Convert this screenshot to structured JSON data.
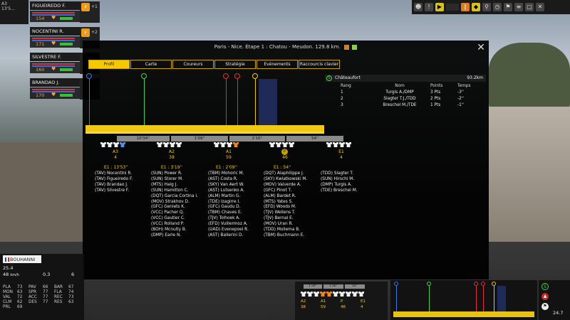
{
  "window": {
    "stage_short": "A3",
    "stage_time": "13'5..."
  },
  "riders": [
    {
      "name": "FIGUEIREDO F.",
      "value": "154",
      "side_badge": "+1"
    },
    {
      "name": "NOCENTINI R.",
      "value": "171",
      "side_badge": "+2"
    },
    {
      "name": "SILVESTRE F.",
      "value": "160",
      "side_badge": ""
    },
    {
      "name": "BRANDAO J.",
      "value": "170",
      "side_badge": ""
    }
  ],
  "modal": {
    "title": "Paris - Nice. Étape 1 : Chatou - Meudon. 129.8 km.",
    "close": "✕",
    "tabs": [
      "Profil",
      "Carte",
      "Coureurs",
      "Stratégie",
      "Evénements",
      "Raccourcis clavier"
    ],
    "active_tab": 0
  },
  "classification": {
    "icon": "S",
    "location": "Châteaufort",
    "distance": "93.2km",
    "columns": {
      "rang": "Rang",
      "nom": "Nom",
      "points": "Points",
      "temps": "Temps"
    },
    "rows": [
      {
        "rang": "1",
        "nom": "Turgis A./DMP",
        "points": "3 Pts",
        "temps": "-3''"
      },
      {
        "rang": "2",
        "nom": "Slagter T.J./TDD",
        "points": "2 Pts",
        "temps": "-2''"
      },
      {
        "rang": "3",
        "nom": "Breschel M./TDE",
        "points": "1 Pts",
        "temps": "-1''"
      }
    ]
  },
  "profile": {
    "markers": [
      {
        "label": "",
        "color": "#3a78e0",
        "pos": 0.02
      },
      {
        "label": "S",
        "color": "#4ad04a",
        "pos": 0.25
      },
      {
        "label": "3",
        "color": "#e03030",
        "pos": 0.58
      },
      {
        "label": "2",
        "color": "#e03030",
        "pos": 0.63
      },
      {
        "label": "S",
        "color": "#f5c800",
        "pos": 0.71
      }
    ]
  },
  "time_gaps": [
    "10'34''",
    "1'09''",
    "1'16''",
    "54''"
  ],
  "groups": [
    {
      "label": "A3",
      "count": "4",
      "gap": "E1 : 13'53''",
      "riders": [
        "(TAV) Nocentini R.",
        "(TAV) Figueiredo F.",
        "(TAV) Brandao J.",
        "(TAV) Silvestre F."
      ]
    },
    {
      "label": "A2",
      "count": "38",
      "gap": "E1 : 3'19''",
      "riders": [
        "(SUN) Power R.",
        "(SUN) Storer M.",
        "(MTS) Haig J.",
        "(SUN) Hamilton C.",
        "(DQT) Garcia Cortina I.",
        "(MOV) Strakhov D.",
        "(GFC) Geniets K.",
        "(VCC) Pacher Q.",
        "(VCC) Gautier C.",
        "(VCC) Rolland P.",
        "(BOH) Mcnulty B.",
        "(DMP) Earle N."
      ]
    },
    {
      "label": "A1",
      "count": "59",
      "gap": "E1 : 2'09''",
      "riders": [
        "(TBM) Mohoric M.",
        "(AST) Costa R.",
        "(SKY) Van Aert W.",
        "(AST) Lutsenko A.",
        "(ALM) Martin G.",
        "(TDE) Izagirre I.",
        "(GFC) Gaudu D.",
        "(TBM) Chaves E.",
        "(TJV) Tolhoek A.",
        "(EFD) Vuillermoz A.",
        "(UAD) Evenepoel R.",
        "(AST) Ballerini D."
      ]
    },
    {
      "label": "P",
      "count": "46",
      "gap": "E1 : 54''",
      "riders": [
        "(DQT) Alaphilippe J.",
        "(SKY) Kwiatkowski M.",
        "(MOV) Valverde A.",
        "(GFC) Pinot T.",
        "(ALM) Bardet R.",
        "(MTS) Yates S.",
        "(EFD) Woods M.",
        "(TJV) Wellens T.",
        "(TJV) Bernal E.",
        "(MOV) Uran R.",
        "(TDD) Mollema B.",
        "(TBM) Buchmann E."
      ]
    },
    {
      "label": "E1",
      "count": "4",
      "gap": "",
      "riders": [
        "(TDD) Slagter T.",
        "(SUN) Hirschi M.",
        "(DMP) Turgis A.",
        "(TDE) Breschel M."
      ]
    }
  ],
  "rider_stats": {
    "name": "BOUHANNI N.",
    "speed": "25.4",
    "speed2": "48",
    "speed_unit": "km/h",
    "grade": "0.3",
    "number": "6",
    "table": [
      [
        "PLA",
        "73",
        "PAV",
        "66",
        "BAR",
        "67"
      ],
      [
        "MON",
        "63",
        "SPR",
        "77",
        "FLA",
        "74"
      ],
      [
        "VAL",
        "72",
        "ACC",
        "77",
        "REC",
        "73"
      ],
      [
        "CLM",
        "62",
        "DES",
        "77",
        "RES",
        "63"
      ],
      [
        "PRL",
        "69",
        "",
        "",
        "",
        ""
      ]
    ]
  },
  "mini": {
    "gaps": [
      "1'29''",
      "1'16''",
      "54''"
    ],
    "groups": [
      {
        "label": "A2",
        "count": "38"
      },
      {
        "label": "A1",
        "count": "59"
      },
      {
        "label": "P",
        "count": "46"
      },
      {
        "label": "E1",
        "count": "4"
      }
    ],
    "right_value": "24.7"
  }
}
